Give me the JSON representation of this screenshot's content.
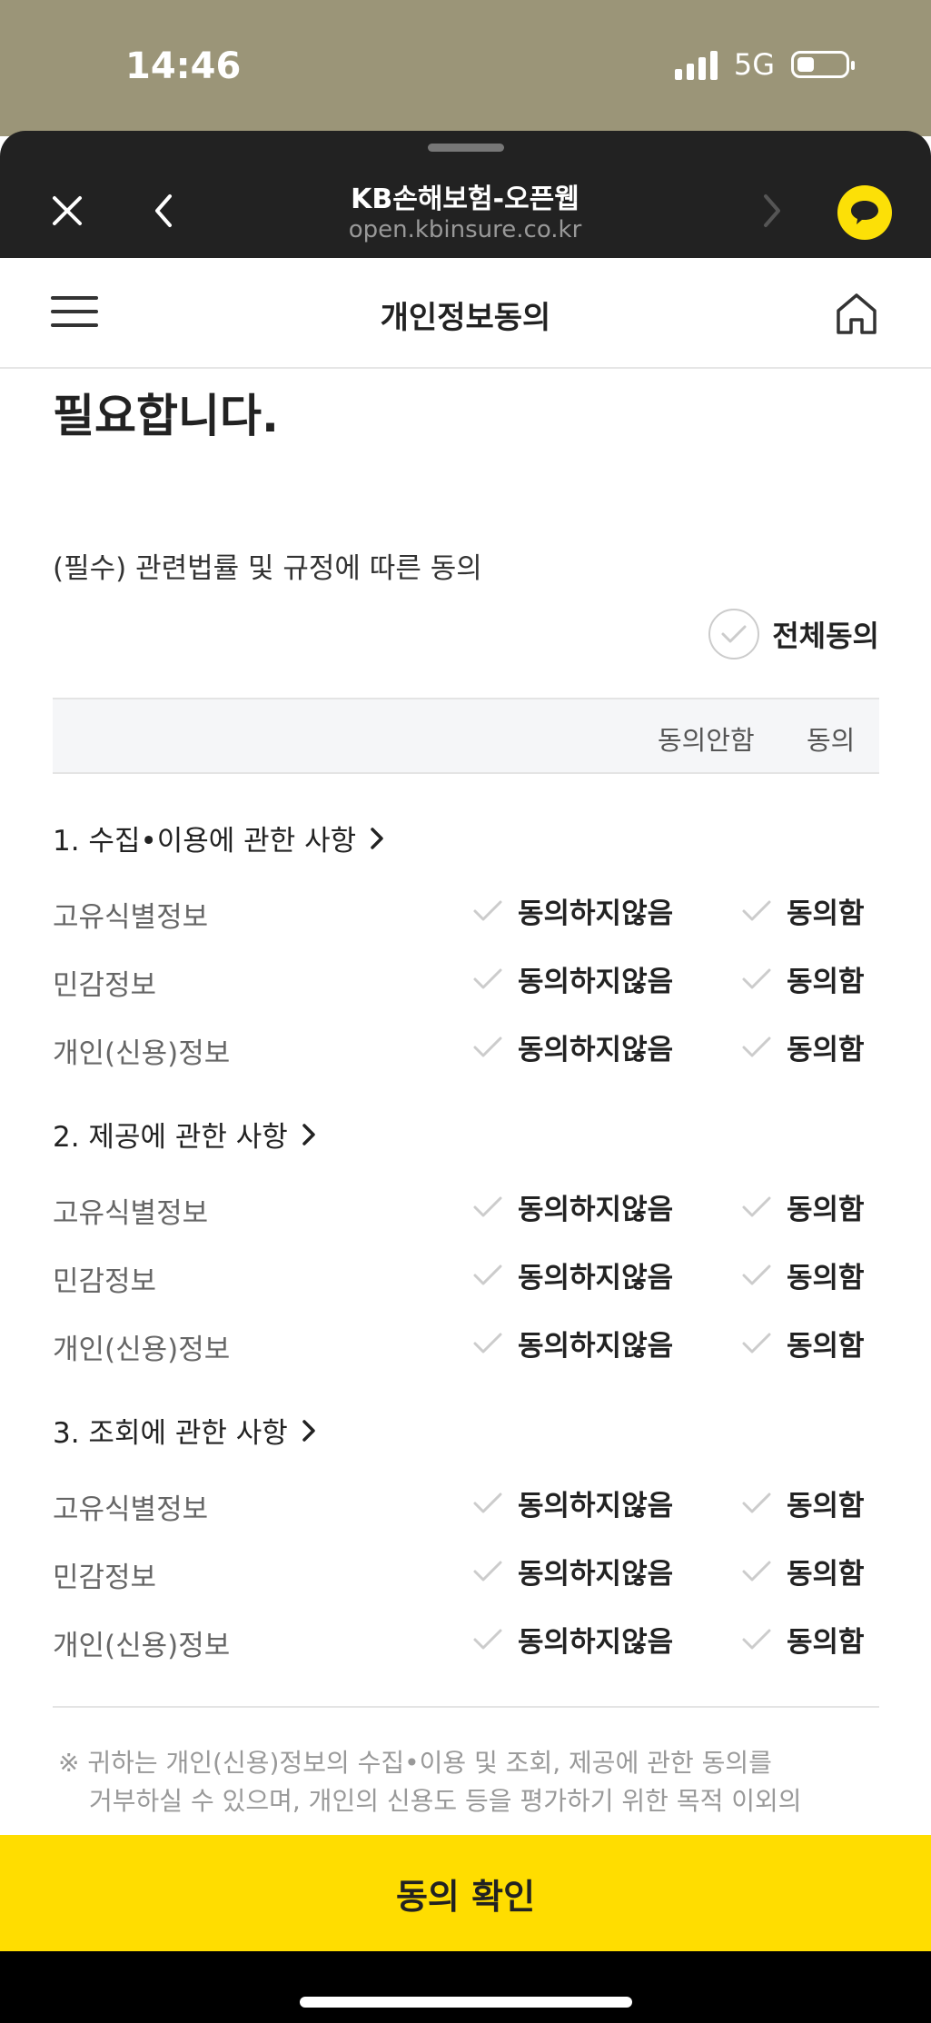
{
  "status": {
    "time": "14:46",
    "network": "5G"
  },
  "browser": {
    "title": "KB손해보험-오픈웹",
    "url": "open.kbinsure.co.kr"
  },
  "header": {
    "title": "개인정보동의"
  },
  "content": {
    "heading": "필요합니다.",
    "required_title": "(필수) 관련법률 및 규정에 따른 동의",
    "all_agree_label": "전체동의",
    "columns": {
      "disagree": "동의안함",
      "agree": "동의"
    },
    "sections": [
      {
        "title": "1. 수집•이용에 관한 사항",
        "rows": [
          {
            "label": "고유식별정보",
            "no": "동의하지않음",
            "yes": "동의함"
          },
          {
            "label": "민감정보",
            "no": "동의하지않음",
            "yes": "동의함"
          },
          {
            "label": "개인(신용)정보",
            "no": "동의하지않음",
            "yes": "동의함"
          }
        ]
      },
      {
        "title": "2. 제공에 관한 사항",
        "rows": [
          {
            "label": "고유식별정보",
            "no": "동의하지않음",
            "yes": "동의함"
          },
          {
            "label": "민감정보",
            "no": "동의하지않음",
            "yes": "동의함"
          },
          {
            "label": "개인(신용)정보",
            "no": "동의하지않음",
            "yes": "동의함"
          }
        ]
      },
      {
        "title": "3. 조회에 관한 사항",
        "rows": [
          {
            "label": "고유식별정보",
            "no": "동의하지않음",
            "yes": "동의함"
          },
          {
            "label": "민감정보",
            "no": "동의하지않음",
            "yes": "동의함"
          },
          {
            "label": "개인(신용)정보",
            "no": "동의하지않음",
            "yes": "동의함"
          }
        ]
      }
    ],
    "note_line1": "※ 귀하는 개인(신용)정보의 수집•이용 및 조회, 제공에 관한 동의를",
    "note_line2": "거부하실 수 있으며, 개인의 신용도 등을 평가하기 위한 목적 이외의"
  },
  "footer": {
    "confirm_label": "동의 확인"
  }
}
